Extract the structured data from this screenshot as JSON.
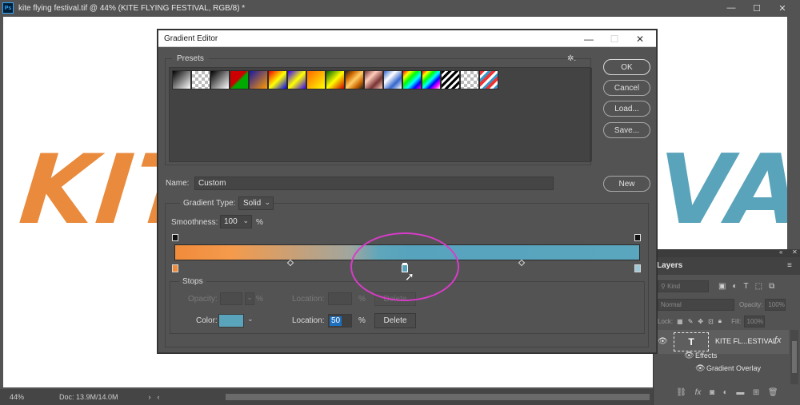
{
  "app": {
    "logo_text": "Ps",
    "doc_title": "kite flying festival.tif @ 44% (KITE FLYING FESTIVAL, RGB/8) *",
    "window_buttons": [
      "—",
      "☐",
      "✕"
    ]
  },
  "canvas": {
    "kite_left_text": "KITE",
    "kite_right_text": "VAL",
    "colors": {
      "orange": "#e98a3c",
      "blue": "#5aa4bb"
    }
  },
  "status_bar": {
    "zoom": "44%",
    "doc_size": "Doc: 13.9M/14.0M",
    "arrow": "›"
  },
  "layers_panel": {
    "tab_label": "Layers",
    "kind_placeholder": "Kind",
    "blend_mode": "Normal",
    "opacity_label": "Opacity:",
    "opacity_value": "100%",
    "lock_label": "Lock:",
    "fill_label": "Fill:",
    "fill_value": "100%",
    "layer_name": "KITE FL...ESTIVAL",
    "layer_thumb_glyph": "T",
    "fx_label": "fx",
    "effects_label": "Effects",
    "gradient_overlay_label": "Gradient Overlay",
    "bottom_icons": [
      "link-icon",
      "fx-icon",
      "mask-icon",
      "adjustment-icon",
      "folder-icon",
      "new-layer-icon",
      "trash-icon"
    ]
  },
  "dialog": {
    "title": "Gradient Editor",
    "presets_label": "Presets",
    "gear_glyph": "✲.",
    "buttons": {
      "ok": "OK",
      "cancel": "Cancel",
      "load": "Load...",
      "save": "Save...",
      "new": "New"
    },
    "name_label": "Name:",
    "name_value": "Custom",
    "gradient_type_label": "Gradient Type:",
    "gradient_type_value": "Solid",
    "smoothness_label": "Smoothness:",
    "smoothness_value": "100",
    "smoothness_unit": "%",
    "stops": {
      "label": "Stops",
      "opacity_label": "Opacity:",
      "opacity_unit": "%",
      "opacity_location_label": "Location:",
      "opacity_location_unit": "%",
      "opacity_delete_label": "Delete",
      "color_label": "Color:",
      "color_value": "#5aa4bb",
      "location_label": "Location:",
      "location_value": "50",
      "location_unit": "%",
      "delete_label": "Delete"
    },
    "gradient_colors": {
      "start": "#f08b3b",
      "end": "#5aa6bf"
    },
    "color_stops_percent": [
      0,
      50,
      100
    ],
    "opacity_stops_percent": [
      0,
      100
    ],
    "midpoints_percent": [
      25,
      75
    ]
  },
  "annotation": {
    "circle_color": "#d83cc8"
  }
}
